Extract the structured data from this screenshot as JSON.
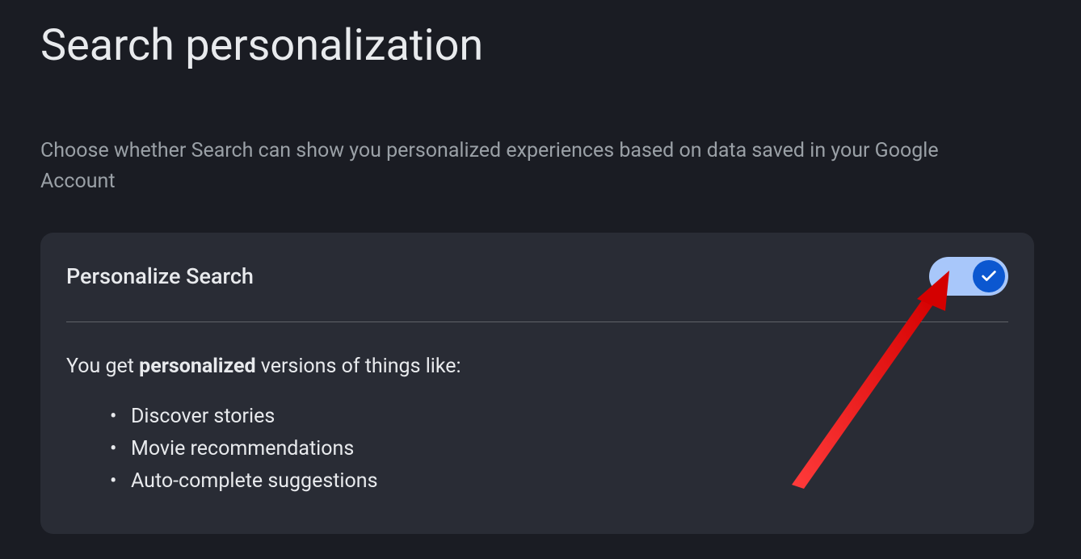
{
  "page": {
    "title": "Search personalization",
    "description": "Choose whether Search can show you personalized experiences based on data saved in your Google Account"
  },
  "card": {
    "title": "Personalize Search",
    "toggle_on": true,
    "body_intro_prefix": "You get ",
    "body_intro_bold": "personalized",
    "body_intro_suffix": " versions of things like:",
    "bullets": [
      "Discover stories",
      "Movie recommendations",
      "Auto-complete suggestions"
    ]
  },
  "colors": {
    "background": "#1a1c23",
    "card_background": "#292c35",
    "toggle_track": "#a8c7fa",
    "toggle_knob": "#0b57d0",
    "annotation_arrow": "#e83015"
  }
}
